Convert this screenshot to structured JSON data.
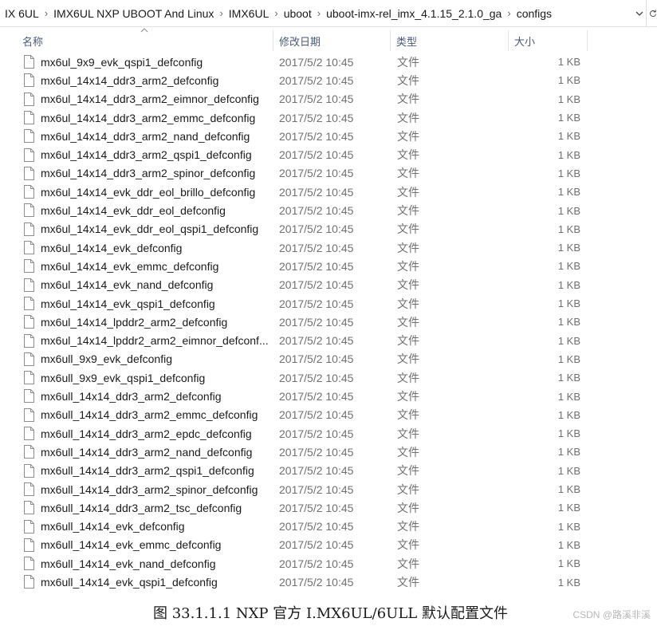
{
  "breadcrumb": [
    "IX 6UL",
    "IMX6UL NXP UBOOT And Linux",
    "IMX6UL",
    "uboot",
    "uboot-imx-rel_imx_4.1.15_2.1.0_ga",
    "configs"
  ],
  "header": {
    "name": "名称",
    "date": "修改日期",
    "type": "类型",
    "size": "大小"
  },
  "icons": {
    "address_dropdown": "chevron-down-icon",
    "refresh": "refresh-icon",
    "file": "file-icon",
    "sort": "sort-up-icon"
  },
  "files": [
    {
      "name": "mx6ul_9x9_evk_qspi1_defconfig",
      "date": "2017/5/2 10:45",
      "type": "文件",
      "size": "1 KB"
    },
    {
      "name": "mx6ul_14x14_ddr3_arm2_defconfig",
      "date": "2017/5/2 10:45",
      "type": "文件",
      "size": "1 KB"
    },
    {
      "name": "mx6ul_14x14_ddr3_arm2_eimnor_defconfig",
      "date": "2017/5/2 10:45",
      "type": "文件",
      "size": "1 KB"
    },
    {
      "name": "mx6ul_14x14_ddr3_arm2_emmc_defconfig",
      "date": "2017/5/2 10:45",
      "type": "文件",
      "size": "1 KB"
    },
    {
      "name": "mx6ul_14x14_ddr3_arm2_nand_defconfig",
      "date": "2017/5/2 10:45",
      "type": "文件",
      "size": "1 KB"
    },
    {
      "name": "mx6ul_14x14_ddr3_arm2_qspi1_defconfig",
      "date": "2017/5/2 10:45",
      "type": "文件",
      "size": "1 KB"
    },
    {
      "name": "mx6ul_14x14_ddr3_arm2_spinor_defconfig",
      "date": "2017/5/2 10:45",
      "type": "文件",
      "size": "1 KB"
    },
    {
      "name": "mx6ul_14x14_evk_ddr_eol_brillo_defconfig",
      "date": "2017/5/2 10:45",
      "type": "文件",
      "size": "1 KB"
    },
    {
      "name": "mx6ul_14x14_evk_ddr_eol_defconfig",
      "date": "2017/5/2 10:45",
      "type": "文件",
      "size": "1 KB"
    },
    {
      "name": "mx6ul_14x14_evk_ddr_eol_qspi1_defconfig",
      "date": "2017/5/2 10:45",
      "type": "文件",
      "size": "1 KB"
    },
    {
      "name": "mx6ul_14x14_evk_defconfig",
      "date": "2017/5/2 10:45",
      "type": "文件",
      "size": "1 KB"
    },
    {
      "name": "mx6ul_14x14_evk_emmc_defconfig",
      "date": "2017/5/2 10:45",
      "type": "文件",
      "size": "1 KB"
    },
    {
      "name": "mx6ul_14x14_evk_nand_defconfig",
      "date": "2017/5/2 10:45",
      "type": "文件",
      "size": "1 KB"
    },
    {
      "name": "mx6ul_14x14_evk_qspi1_defconfig",
      "date": "2017/5/2 10:45",
      "type": "文件",
      "size": "1 KB"
    },
    {
      "name": "mx6ul_14x14_lpddr2_arm2_defconfig",
      "date": "2017/5/2 10:45",
      "type": "文件",
      "size": "1 KB"
    },
    {
      "name": "mx6ul_14x14_lpddr2_arm2_eimnor_defconf...",
      "date": "2017/5/2 10:45",
      "type": "文件",
      "size": "1 KB"
    },
    {
      "name": "mx6ull_9x9_evk_defconfig",
      "date": "2017/5/2 10:45",
      "type": "文件",
      "size": "1 KB"
    },
    {
      "name": "mx6ull_9x9_evk_qspi1_defconfig",
      "date": "2017/5/2 10:45",
      "type": "文件",
      "size": "1 KB"
    },
    {
      "name": "mx6ull_14x14_ddr3_arm2_defconfig",
      "date": "2017/5/2 10:45",
      "type": "文件",
      "size": "1 KB"
    },
    {
      "name": "mx6ull_14x14_ddr3_arm2_emmc_defconfig",
      "date": "2017/5/2 10:45",
      "type": "文件",
      "size": "1 KB"
    },
    {
      "name": "mx6ull_14x14_ddr3_arm2_epdc_defconfig",
      "date": "2017/5/2 10:45",
      "type": "文件",
      "size": "1 KB"
    },
    {
      "name": "mx6ull_14x14_ddr3_arm2_nand_defconfig",
      "date": "2017/5/2 10:45",
      "type": "文件",
      "size": "1 KB"
    },
    {
      "name": "mx6ull_14x14_ddr3_arm2_qspi1_defconfig",
      "date": "2017/5/2 10:45",
      "type": "文件",
      "size": "1 KB"
    },
    {
      "name": "mx6ull_14x14_ddr3_arm2_spinor_defconfig",
      "date": "2017/5/2 10:45",
      "type": "文件",
      "size": "1 KB"
    },
    {
      "name": "mx6ull_14x14_ddr3_arm2_tsc_defconfig",
      "date": "2017/5/2 10:45",
      "type": "文件",
      "size": "1 KB"
    },
    {
      "name": "mx6ull_14x14_evk_defconfig",
      "date": "2017/5/2 10:45",
      "type": "文件",
      "size": "1 KB"
    },
    {
      "name": "mx6ull_14x14_evk_emmc_defconfig",
      "date": "2017/5/2 10:45",
      "type": "文件",
      "size": "1 KB"
    },
    {
      "name": "mx6ull_14x14_evk_nand_defconfig",
      "date": "2017/5/2 10:45",
      "type": "文件",
      "size": "1 KB"
    },
    {
      "name": "mx6ull_14x14_evk_qspi1_defconfig",
      "date": "2017/5/2 10:45",
      "type": "文件",
      "size": "1 KB"
    }
  ],
  "caption": "图 33.1.1.1 NXP 官方 I.MX6UL/6ULL 默认配置文件",
  "watermark": "CSDN @路溪非溪"
}
